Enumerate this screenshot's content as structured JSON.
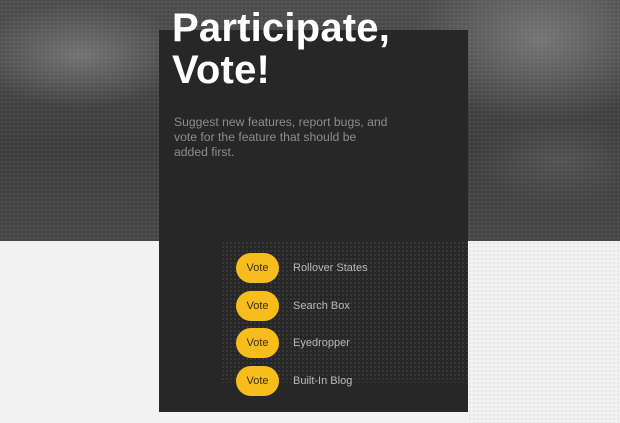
{
  "hero": {
    "heading_line1": "Participate,",
    "heading_line2": "Vote!",
    "description": "Suggest new features, report bugs, and vote for the feature that should be added first."
  },
  "colors": {
    "accent": "#f7bd1c",
    "panel": "#272727",
    "page_background": "#f2f2f2"
  },
  "features": [
    {
      "vote_label": "Vote",
      "name": "Rollover States"
    },
    {
      "vote_label": "Vote",
      "name": "Search Box"
    },
    {
      "vote_label": "Vote",
      "name": "Eyedropper"
    },
    {
      "vote_label": "Vote",
      "name": "Built-In Blog"
    }
  ]
}
